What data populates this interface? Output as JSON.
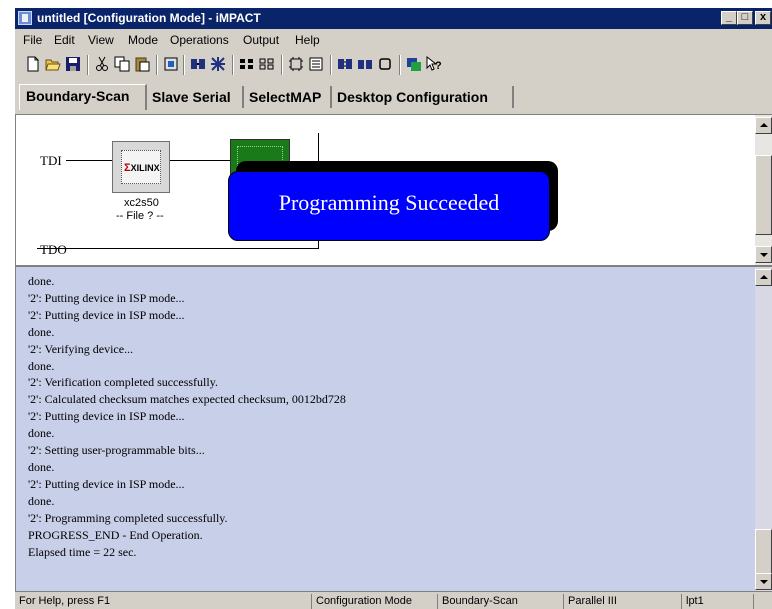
{
  "window": {
    "title": "untitled [Configuration Mode] - iMPACT"
  },
  "menu": [
    "File",
    "Edit",
    "View",
    "Mode",
    "Operations",
    "Output",
    "Help"
  ],
  "tabs": [
    "Boundary-Scan",
    "Slave Serial",
    "SelectMAP",
    "Desktop Configuration"
  ],
  "active_tab": "Boundary-Scan",
  "diagram": {
    "tdi_label": "TDI",
    "tdo_label": "TDO",
    "device_name": "xc2s50",
    "device_file": "-- File ? --",
    "logo_text": "XILINX",
    "popup_message": "Programming Succeeded"
  },
  "log": [
    "done.",
    "'2': Putting device in ISP mode...",
    "'2': Putting device in ISP mode...",
    "done.",
    "'2': Verifying device...",
    "done.",
    "'2': Verification completed successfully.",
    "'2': Calculated checksum matches expected checksum, 0012bd728",
    "'2': Putting device in ISP mode...",
    "done.",
    "'2': Setting user-programmable bits...",
    "done.",
    "'2': Putting device in ISP mode...",
    "done.",
    "'2': Programming completed successfully.",
    "PROGRESS_END - End Operation.",
    "Elapsed time =     22 sec."
  ],
  "status": {
    "help": "For Help, press F1",
    "mode": "Configuration Mode",
    "scan": "Boundary-Scan",
    "cable": "Parallel III",
    "port": "lpt1"
  },
  "icons": [
    "app-icon",
    "new-icon",
    "open-icon",
    "save-icon",
    "cut-icon",
    "copy-icon",
    "paste-icon",
    "identify-chain-icon",
    "program-icon",
    "erase-icon",
    "verify-icon",
    "readback-icon",
    "blank-check-icon",
    "get-idcode-icon",
    "cable-setup-icon",
    "help-context-icon"
  ]
}
